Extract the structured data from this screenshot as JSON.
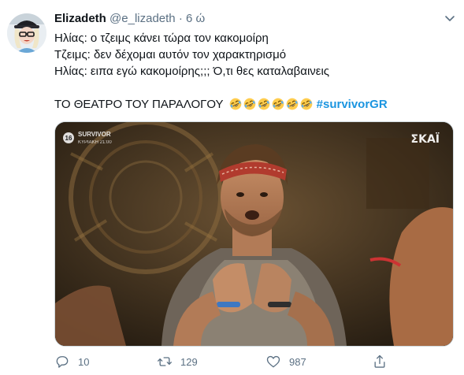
{
  "user": {
    "name": "Elizadeth",
    "handle": "@e_lizadeth",
    "separator": "·",
    "time": "6 ώ"
  },
  "tweet": {
    "lines": [
      "Ηλίας: ο τζειμς κάνει τώρα τον κακομοίρη",
      "Τζειμς: δεν δέχομαι αυτόν τον χαρακτηρισμό",
      "Ηλίας: ειπα εγώ κακομοίρης;;; Ό,τι θες καταλαβαινεις"
    ],
    "last_line_text": "ΤΟ ΘΕΑΤΡΟ ΤΟΥ ΠΑΡΑΛΟΓΟΥ",
    "emoji_name": "rolling-on-the-floor-laughing-icon",
    "emoji_count": 6,
    "hashtag": "#survivorGR"
  },
  "media": {
    "channel_badge": "16",
    "show_title": "SURVIVOR",
    "show_schedule": "ΚΥΡΙΑΚΗ 21:00",
    "network_logo": "ΣΚΑΪ"
  },
  "actions": {
    "replies": "10",
    "retweets": "129",
    "likes": "987"
  },
  "colors": {
    "accent": "#1b95e0",
    "muted": "#5b7083",
    "border": "#cfd9de"
  }
}
